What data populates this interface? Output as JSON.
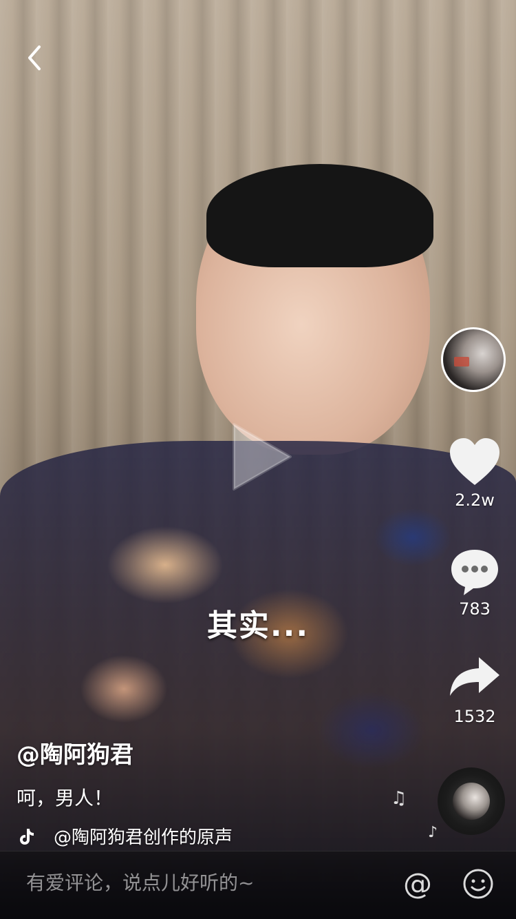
{
  "video": {
    "subtitle": "其实..."
  },
  "rail": {
    "like_count": "2.2w",
    "comment_count": "783",
    "share_count": "1532",
    "icons": [
      "heart-icon",
      "comment-icon",
      "share-icon",
      "music-note-icon"
    ]
  },
  "info": {
    "author": "@陶阿狗君",
    "description": "呵，男人！",
    "music": "@陶阿狗君创作的原声"
  },
  "comment_bar": {
    "placeholder": "有爱评论，说点儿好听的~",
    "at_label": "@"
  }
}
